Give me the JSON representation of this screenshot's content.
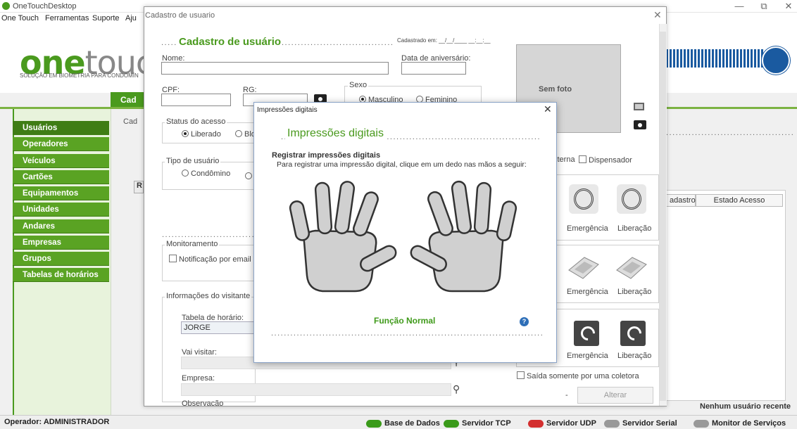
{
  "main_window": {
    "title": "OneTouchDesktop",
    "menu": [
      "One Touch",
      "Ferramentas",
      "Suporte",
      "Aju"
    ],
    "logo_one": "one",
    "logo_touch": "touc",
    "logo_subtitle": "SOLUÇÃO EM BIOMETRIA PARA CONDOMÍN",
    "tab_label": "Cad",
    "cad_label": "Cad",
    "r_tab": "R",
    "minimize": "—",
    "restore": "⧉",
    "close": "✕"
  },
  "sidebar": {
    "items": [
      {
        "label": "Usuários",
        "active": true
      },
      {
        "label": "Operadores"
      },
      {
        "label": "Veículos"
      },
      {
        "label": "Cartões"
      },
      {
        "label": "Equipamentos"
      },
      {
        "label": "Unidades"
      },
      {
        "label": "Andares"
      },
      {
        "label": "Empresas"
      },
      {
        "label": "Grupos"
      },
      {
        "label": "Tabelas de horários"
      }
    ]
  },
  "status_bar": {
    "operator": "Operador: ADMINISTRADOR",
    "items": [
      {
        "label": "Base de Dados",
        "state": "green"
      },
      {
        "label": "Servidor TCP",
        "state": "green"
      },
      {
        "label": "Servidor UDP",
        "state": "red"
      },
      {
        "label": "Servidor Serial",
        "state": "gray"
      },
      {
        "label": "Monitor de Serviços",
        "state": "gray"
      }
    ]
  },
  "background": {
    "table_columns": [
      "adastro",
      "Estado Acesso"
    ],
    "recent_users": "Nenhum usuário recente"
  },
  "cadastro": {
    "window_title": "Cadastro de usuario",
    "close": "✕",
    "heading": "Cadastro de usuário",
    "cadastrado_em": "Cadastrado em: __/__/____ __:__:__",
    "nome_label": "Nome:",
    "data_aniversario_label": "Data de aniversário:",
    "cpf_label": "CPF:",
    "rg_label": "RG:",
    "sexo_label": "Sexo",
    "sexo_masculino": "Masculino",
    "sexo_feminino": "Feminino",
    "status_label": "Status do acesso",
    "status_liberado": "Liberado",
    "status_bloqueado": "Blo",
    "tipo_label": "Tipo de usuário",
    "tipo_condomino": "Condômino",
    "monitoramento_label": "Monitoramento",
    "notificacao_email": "Notificação por email",
    "info_visitante_label": "Informações do visitante",
    "tabela_horario_label": "Tabela de horário:",
    "tabela_horario_value": "JORGE",
    "vai_visitar_label": "Vai visitar:",
    "empresa_label": "Empresa:",
    "observacao_label": "Observação",
    "sem_foto": "Sem foto",
    "externa_label": "xterna",
    "dispensador_label": "Dispensador",
    "emergencia": "Emergência",
    "liberacao": "Liberação",
    "saida_coletora": "Saída somente por uma coletora",
    "dash": "-",
    "alterar": "Alterar"
  },
  "impressoes": {
    "window_title": "Impressões digitais",
    "close": "✕",
    "heading": "Impressões digitais",
    "subtitle": "Registrar impressões digitais",
    "instruction": "Para registrar uma impressão digital, clique em um dedo nas mãos a seguir:",
    "mode": "Função Normal",
    "help": "?"
  }
}
